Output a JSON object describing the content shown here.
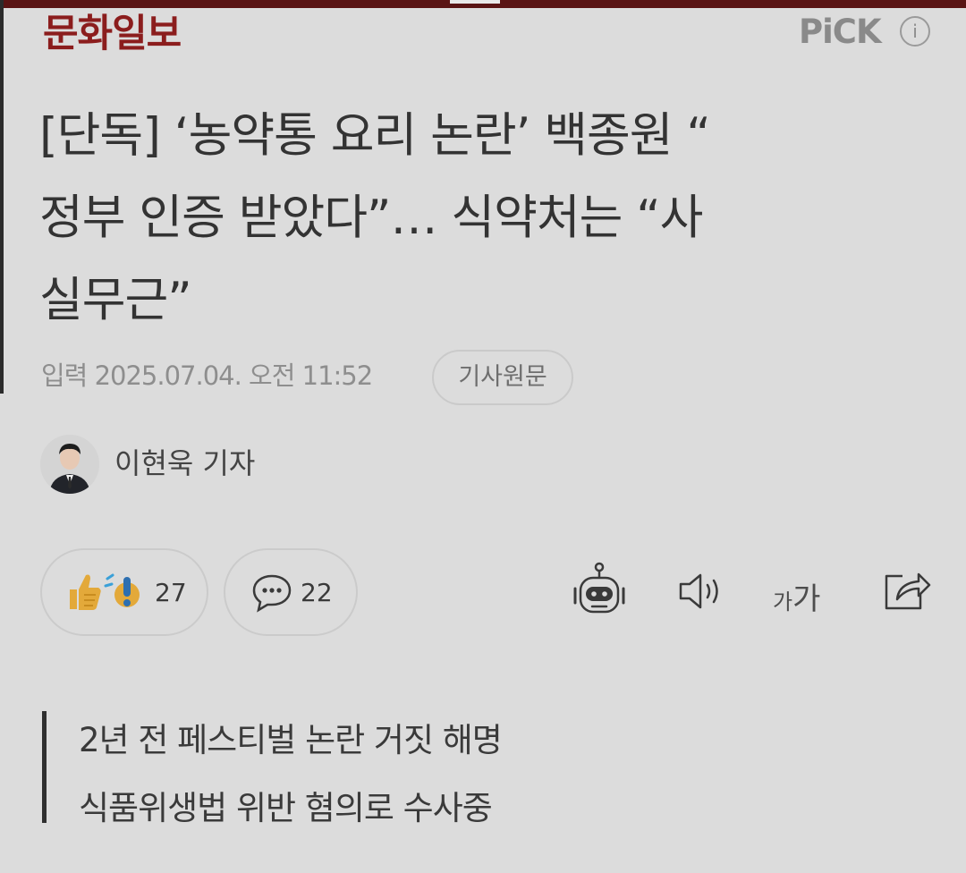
{
  "header": {
    "logo": "문화일보",
    "pick_label": "PiCK",
    "info_icon_label": "i"
  },
  "article": {
    "title_lines": [
      "[단독] ‘농약통 요리 논란’ 백종원 “",
      "정부 인증 받았다”… 식약처는 “사",
      "실무근”"
    ],
    "dateline": "입력 2025.07.04. 오전 11:52",
    "source_button": "기사원문",
    "reporter": "이현욱 기자"
  },
  "actions": {
    "reaction_count": "27",
    "comment_count": "22",
    "font_small": "가",
    "font_large": "가"
  },
  "icons": [
    "thumbs-up-icon",
    "surprise-icon",
    "comment-icon",
    "robot-icon",
    "speaker-icon",
    "font-size-icon",
    "share-icon",
    "info-icon"
  ],
  "summary": {
    "lines": [
      "2년 전 페스티벌 논란 거짓 해명",
      "식품위생법 위반 혐의로 수사중"
    ]
  },
  "colors": {
    "logo": "#8b1d1d",
    "background": "#dcdcdc",
    "text": "#333333",
    "reaction_yellow": "#e3a93a",
    "reaction_blue": "#2d6fb0"
  }
}
